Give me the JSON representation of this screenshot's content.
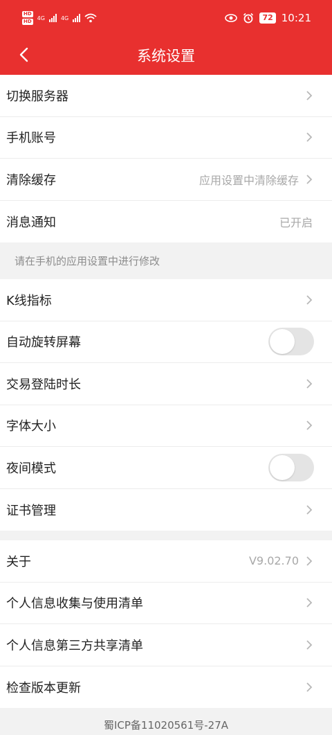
{
  "status_bar": {
    "hd_badges": [
      "HD",
      "HD"
    ],
    "net_labels": [
      "4G",
      "4G"
    ],
    "battery": "72",
    "time": "10:21",
    "icons": [
      "eye-icon",
      "alarm-icon"
    ]
  },
  "header": {
    "title": "系统设置",
    "color": "#e8302f"
  },
  "group1": {
    "items": [
      {
        "label": "切换服务器",
        "value": ""
      },
      {
        "label": "手机账号",
        "value": ""
      },
      {
        "label": "清除缓存",
        "value": "应用设置中清除缓存"
      },
      {
        "label": "消息通知",
        "value": "已开启"
      }
    ]
  },
  "note": "请在手机的应用设置中进行修改",
  "group2": {
    "items": [
      {
        "label": "K线指标"
      },
      {
        "label": "自动旋转屏幕",
        "toggle": false
      },
      {
        "label": "交易登陆时长"
      },
      {
        "label": "字体大小"
      },
      {
        "label": "夜间模式",
        "toggle": false
      },
      {
        "label": "证书管理"
      }
    ]
  },
  "group3": {
    "items": [
      {
        "label": "关于",
        "value": "V9.02.70"
      },
      {
        "label": "个人信息收集与使用清单"
      },
      {
        "label": "个人信息第三方共享清单"
      },
      {
        "label": "检查版本更新"
      }
    ]
  },
  "footer": "蜀ICP备11020561号-27A"
}
